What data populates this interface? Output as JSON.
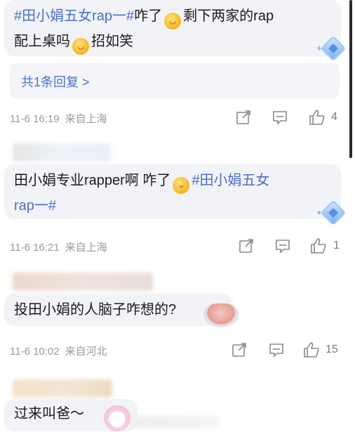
{
  "comments": [
    {
      "hashtag": "#田小娟五女rap一#",
      "text_a": "咋了",
      "text_b": "剩下两家的rap",
      "text_c": "配上桌吗",
      "text_d": "招如笑",
      "reply_link": "共1条回复 >",
      "date": "11-6 16:19",
      "location": "来自上海",
      "likes": "4"
    },
    {
      "text_a": "田小娟专业rapper啊  咋了",
      "hashtag_a": "#田小娟五女",
      "hashtag_b": "rap一#",
      "date": "11-6 16:21",
      "location": "来自上海",
      "likes": "1"
    },
    {
      "text": "投田小娟的人脑子咋想的?",
      "date": "11-6 10:02",
      "location": "来自河北",
      "likes": "15"
    },
    {
      "text": "过来叫爸～"
    }
  ],
  "icons": {
    "share": "share-icon",
    "comment": "comment-icon",
    "like": "thumbs-up-icon"
  },
  "colors": {
    "hashtag": "#4a6fc9",
    "bubble": "#f2f3f7",
    "meta": "#9a9a9a"
  }
}
